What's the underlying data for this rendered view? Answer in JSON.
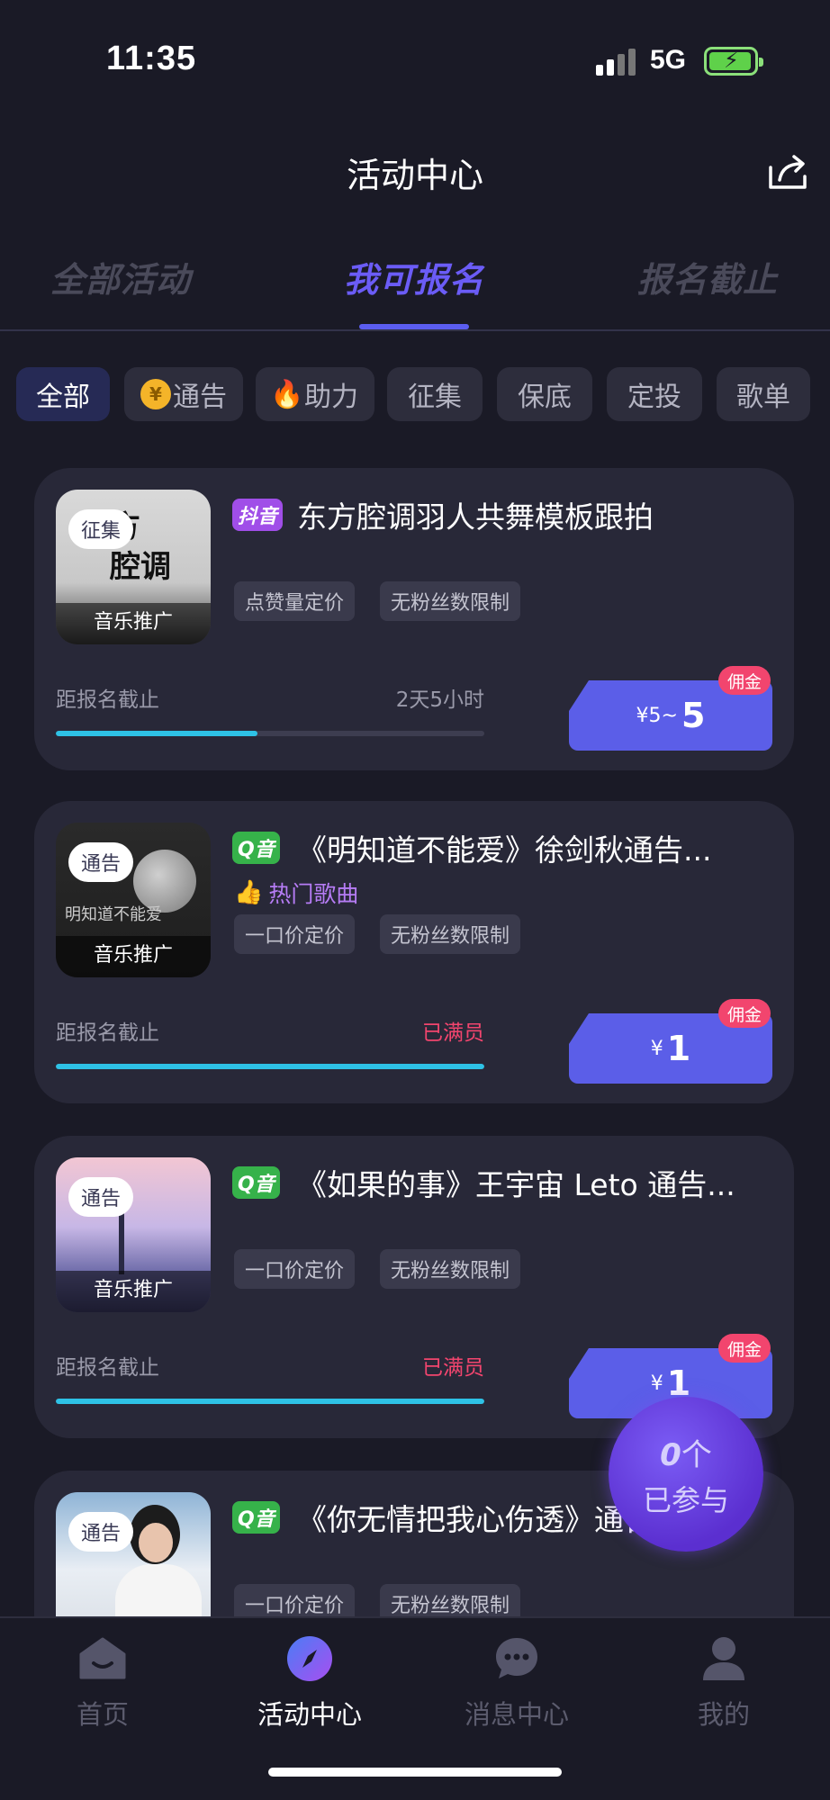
{
  "status_bar": {
    "time": "11:35",
    "network": "5G"
  },
  "header": {
    "title": "活动中心"
  },
  "main_tabs": [
    {
      "label": "全部活动",
      "active": false
    },
    {
      "label": "我可报名",
      "active": true
    },
    {
      "label": "报名截止",
      "active": false
    }
  ],
  "chips": [
    {
      "label": "全部",
      "active": true,
      "icon": ""
    },
    {
      "label": "通告",
      "active": false,
      "icon": "yen-coin-icon",
      "icon_text": "¥"
    },
    {
      "label": "助力",
      "active": false,
      "icon": "fire-icon",
      "icon_text": "🔥"
    },
    {
      "label": "征集",
      "active": false,
      "icon": ""
    },
    {
      "label": "保底",
      "active": false,
      "icon": ""
    },
    {
      "label": "定投",
      "active": false,
      "icon": ""
    },
    {
      "label": "歌单",
      "active": false,
      "icon": ""
    }
  ],
  "cards": [
    {
      "badge": "征集",
      "thumb_footer": "音乐推广",
      "thumb_text": "方\n腔调",
      "platform": "抖音",
      "title": "东方腔调羽人共舞模板跟拍",
      "hot": "",
      "tags": [
        "点赞量定价",
        "无粉丝数限制"
      ],
      "deadline_label": "距报名截止",
      "deadline_value": "2天5小时",
      "deadline_full": false,
      "progress": 0.47,
      "price_prefix": "¥5~",
      "price_value": "5",
      "commission": "佣金"
    },
    {
      "badge": "通告",
      "thumb_footer": "音乐推广",
      "thumb_text": "明知道不能爱",
      "platform": "Q音",
      "title": "《明知道不能爱》徐剑秋通告...",
      "hot": "热门歌曲",
      "tags": [
        "一口价定价",
        "无粉丝数限制"
      ],
      "deadline_label": "距报名截止",
      "deadline_value": "已满员",
      "deadline_full": true,
      "progress": 1.0,
      "price_prefix": "¥",
      "price_value": "1",
      "commission": "佣金"
    },
    {
      "badge": "通告",
      "thumb_footer": "音乐推广",
      "thumb_text": "",
      "platform": "Q音",
      "title": "《如果的事》王宇宙 Leto 通告...",
      "hot": "",
      "tags": [
        "一口价定价",
        "无粉丝数限制"
      ],
      "deadline_label": "距报名截止",
      "deadline_value": "已满员",
      "deadline_full": true,
      "progress": 1.0,
      "price_prefix": "¥",
      "price_value": "1",
      "commission": "佣金"
    },
    {
      "badge": "通告",
      "thumb_footer": "",
      "thumb_text": "",
      "platform": "Q音",
      "title": "《你无情把我心伤透》通告",
      "hot": "",
      "tags": [
        "一口价定价",
        "无粉丝数限制"
      ]
    }
  ],
  "floating": {
    "count": "0",
    "count_unit": "个",
    "label": "已参与"
  },
  "bottom_nav": [
    {
      "label": "首页",
      "icon": "home-icon",
      "active": false
    },
    {
      "label": "活动中心",
      "icon": "compass-icon",
      "active": true
    },
    {
      "label": "消息中心",
      "icon": "chat-bubble-icon",
      "active": false
    },
    {
      "label": "我的",
      "icon": "profile-icon",
      "active": false
    }
  ]
}
